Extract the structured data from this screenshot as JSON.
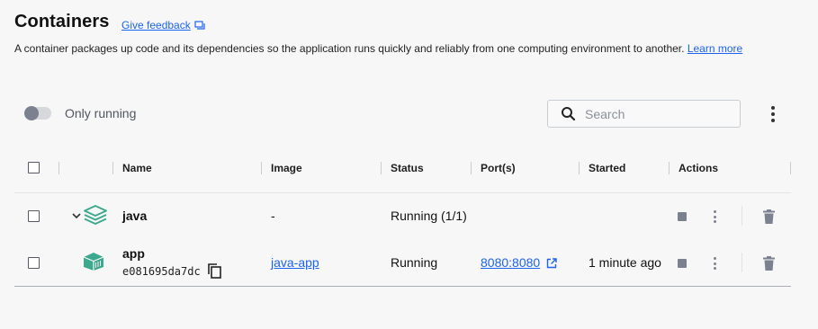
{
  "header": {
    "title": "Containers",
    "feedback_label": "Give feedback",
    "description": "A container packages up code and its dependencies so the application runs quickly and reliably from one computing environment to another.",
    "learn_more_label": "Learn more"
  },
  "toolbar": {
    "only_running_label": "Only running",
    "search_placeholder": "Search"
  },
  "table": {
    "columns": [
      "Name",
      "Image",
      "Status",
      "Port(s)",
      "Started",
      "Actions"
    ],
    "rows": [
      {
        "name": "java",
        "image": "-",
        "status": "Running (1/1)",
        "ports": "",
        "started": ""
      },
      {
        "name": "app",
        "id": "e081695da7dc",
        "image": "java-app",
        "status": "Running",
        "ports": "8080:8080",
        "started": "1 minute ago"
      }
    ]
  },
  "colors": {
    "accent": "#1d63ed",
    "compose_icon": "#3da88e",
    "action_icon": "#7c8190"
  },
  "icons": [
    "feedback-icon",
    "search-icon",
    "more-vert-icon",
    "chevron-down-icon",
    "stack-icon",
    "container-icon",
    "copy-icon",
    "external-link-icon",
    "stop-icon",
    "trash-icon"
  ]
}
